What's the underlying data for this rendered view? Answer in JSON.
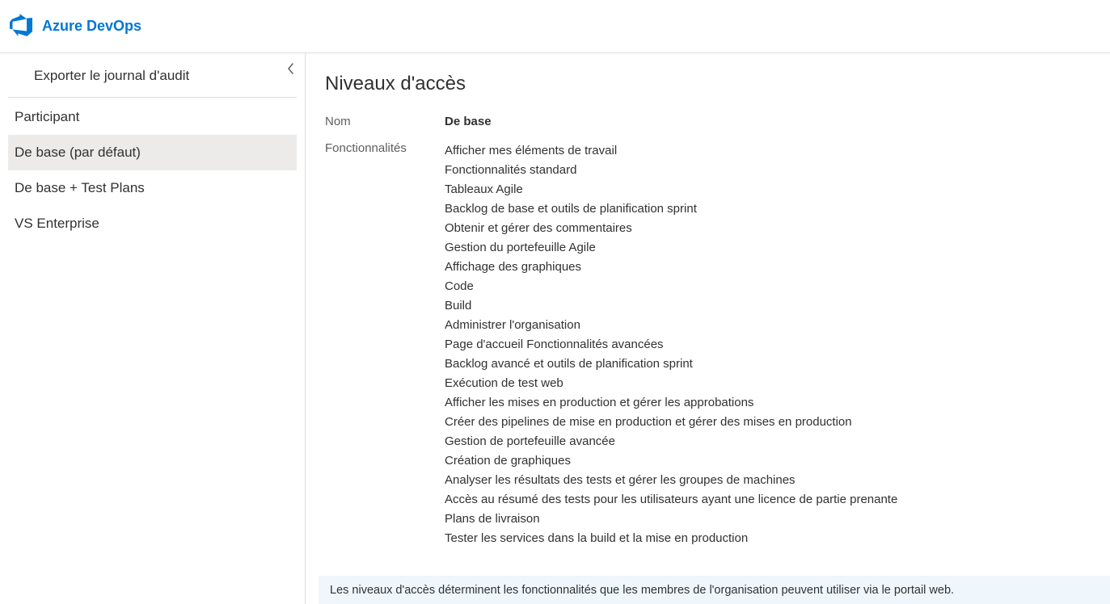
{
  "header": {
    "title": "Azure DevOps"
  },
  "sidebar": {
    "export_label": "Exporter le journal d'audit",
    "items": [
      {
        "label": "Participant",
        "selected": false
      },
      {
        "label": "De base (par défaut)",
        "selected": true
      },
      {
        "label": "De base + Test Plans",
        "selected": false
      },
      {
        "label": "VS Enterprise",
        "selected": false
      }
    ]
  },
  "main": {
    "title": "Niveaux d'accès",
    "name_label": "Nom",
    "name_value": "De base",
    "features_label": "Fonctionnalités",
    "features": [
      "Afficher mes éléments de travail",
      "Fonctionnalités standard",
      "Tableaux Agile",
      "Backlog de base et outils de planification sprint",
      "Obtenir et gérer des commentaires",
      "Gestion du portefeuille Agile",
      "Affichage des graphiques",
      "Code",
      "Build",
      "Administrer l'organisation",
      "Page d'accueil Fonctionnalités avancées",
      "Backlog avancé et outils de planification sprint",
      "Exécution de test web",
      "Afficher les mises en production et gérer les approbations",
      "Créer des pipelines de mise en production et gérer des mises en production",
      "Gestion de portefeuille avancée",
      "Création de graphiques",
      "Analyser les résultats des tests et gérer les groupes de machines",
      "Accès au résumé des tests pour les utilisateurs ayant une licence de partie prenante",
      "Plans de livraison",
      "Tester les services dans la build et la mise en production"
    ],
    "info_text": "Les niveaux d'accès déterminent les fonctionnalités que les membres de l'organisation peuvent utiliser via le portail web."
  }
}
